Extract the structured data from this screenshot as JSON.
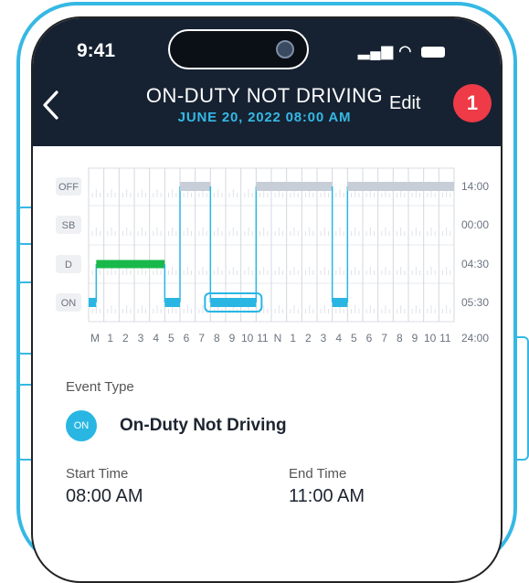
{
  "status_bar": {
    "time": "9:41"
  },
  "header": {
    "title": "ON-DUTY NOT DRIVING",
    "subtitle": "JUNE 20, 2022 08:00 AM",
    "edit_label": "Edit",
    "badge": "1"
  },
  "log_chart": {
    "rows": [
      "OFF",
      "SB",
      "D",
      "ON"
    ],
    "totals": [
      "14:00",
      "00:00",
      "04:30",
      "05:30",
      "24:00"
    ],
    "hour_labels": [
      "M",
      "1",
      "2",
      "3",
      "4",
      "5",
      "6",
      "7",
      "8",
      "9",
      "10",
      "11",
      "N",
      "1",
      "2",
      "3",
      "4",
      "5",
      "6",
      "7",
      "8",
      "9",
      "10",
      "11"
    ],
    "colors": {
      "off": "#c8ced8",
      "driving": "#19b84a",
      "on_duty": "#29b6e3",
      "selected_outline": "#29b6e3"
    },
    "segments": [
      {
        "status": "ON",
        "start": 0,
        "end": 0.5
      },
      {
        "status": "D",
        "start": 0.5,
        "end": 5
      },
      {
        "status": "ON",
        "start": 5,
        "end": 6
      },
      {
        "status": "OFF",
        "start": 6,
        "end": 8
      },
      {
        "status": "ON",
        "start": 8,
        "end": 11,
        "selected": true
      },
      {
        "status": "OFF",
        "start": 11,
        "end": 16
      },
      {
        "status": "ON",
        "start": 16,
        "end": 17
      },
      {
        "status": "OFF",
        "start": 17,
        "end": 24
      }
    ]
  },
  "event": {
    "type_label": "Event Type",
    "status_abbr": "ON",
    "status_name": "On-Duty Not Driving",
    "start_label": "Start Time",
    "start_value": "08:00 AM",
    "end_label": "End Time",
    "end_value": "11:00 AM"
  }
}
